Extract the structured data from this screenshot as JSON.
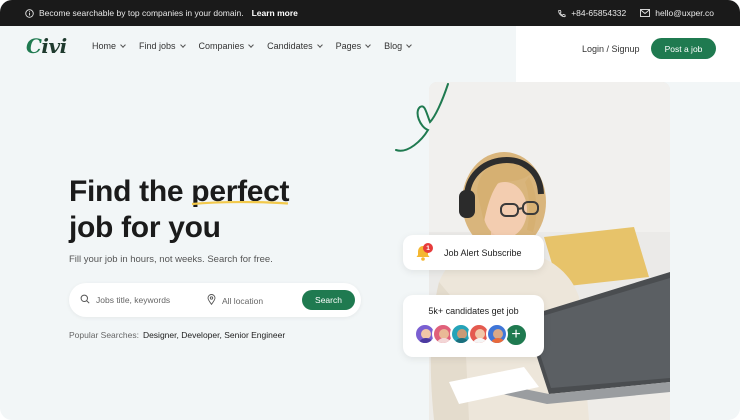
{
  "topbar": {
    "announcement": "Become searchable by top companies in your domain.",
    "learn_more": "Learn more",
    "phone": "+84-65854332",
    "email": "hello@uxper.co"
  },
  "brand": {
    "logo": "Civi",
    "logo_initial": "C",
    "logo_rest": "ivi",
    "accent": "#1f7a50"
  },
  "nav": {
    "items": [
      {
        "label": "Home"
      },
      {
        "label": "Find jobs"
      },
      {
        "label": "Companies"
      },
      {
        "label": "Candidates"
      },
      {
        "label": "Pages"
      },
      {
        "label": "Blog"
      }
    ],
    "login": "Login / Signup",
    "post_job": "Post a job"
  },
  "hero": {
    "title_line1_a": "Find the",
    "title_line1_b": "perfect",
    "title_line2": "job for you",
    "subtitle": "Fill your job in hours, not weeks. Search for free."
  },
  "search": {
    "keyword_placeholder": "Jobs title, keywords",
    "location_placeholder": "All location",
    "button": "Search"
  },
  "popular": {
    "label": "Popular Searches:",
    "values": "Designer, Developer, Senior Engineer"
  },
  "cards": {
    "alert": {
      "text": "Job Alert Subscribe",
      "count": "1"
    },
    "candidates": {
      "text": "5k+ candidates get job",
      "plus": "+"
    }
  },
  "icons": {
    "info": "info-icon",
    "phone": "phone-icon",
    "mail": "mail-icon",
    "search": "search-icon",
    "location": "location-pin-icon",
    "bell": "bell-icon"
  }
}
